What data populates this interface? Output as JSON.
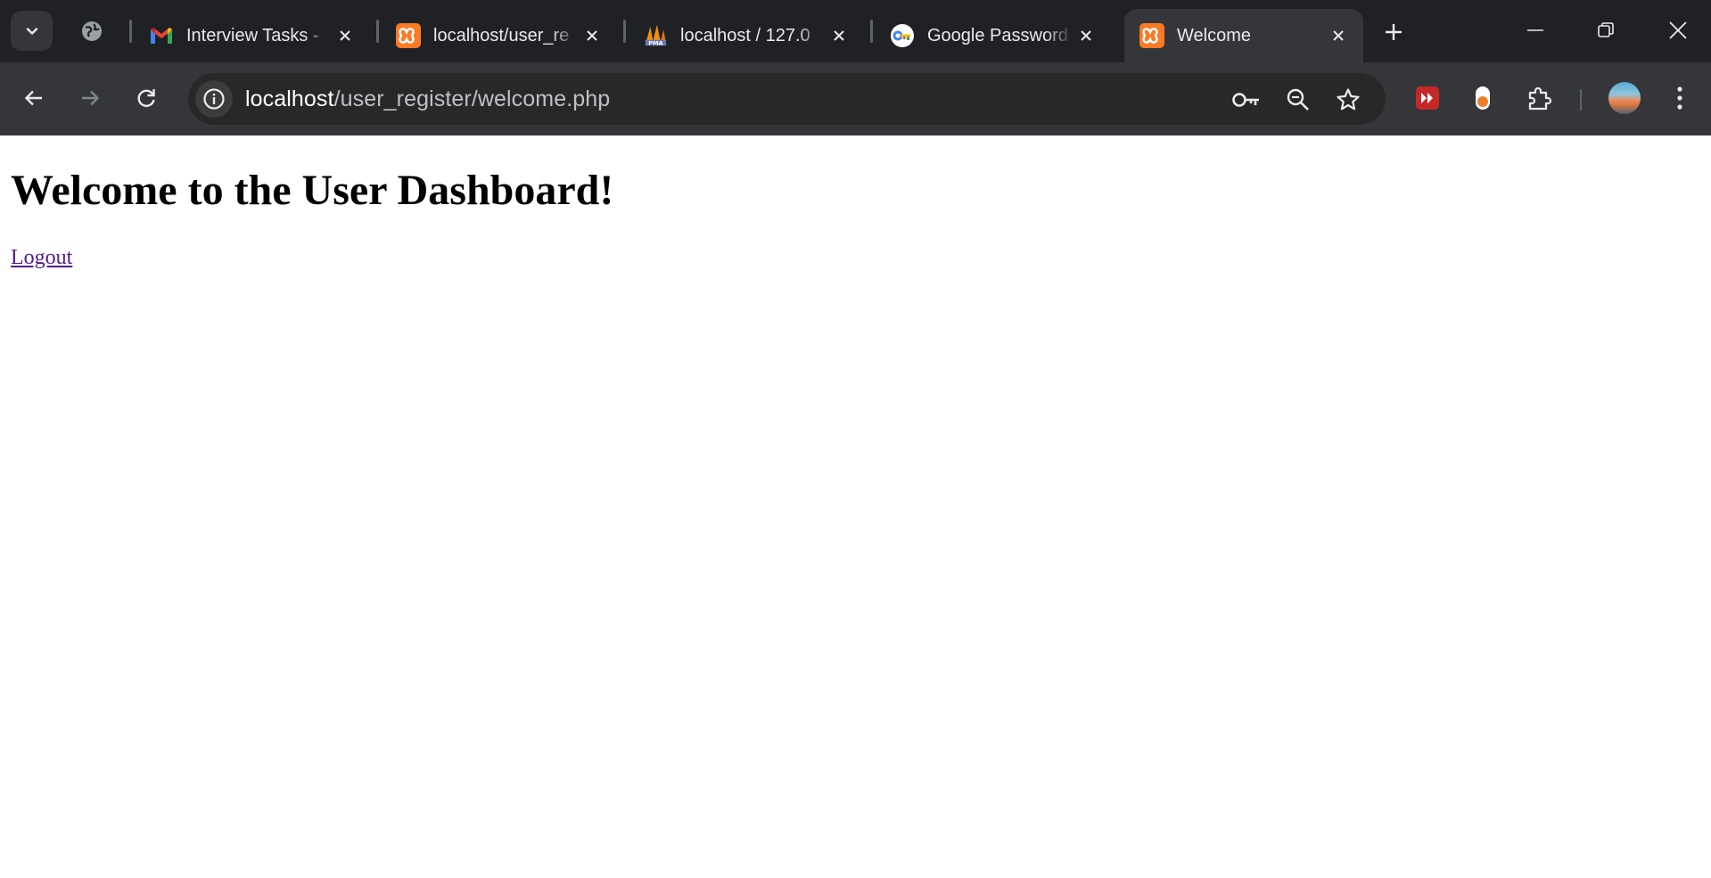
{
  "tabs": [
    {
      "title": "Interview Tasks - ",
      "favicon": "gmail-icon",
      "active": false
    },
    {
      "title": "localhost/user_re",
      "favicon": "xampp-icon",
      "active": false
    },
    {
      "title": "localhost / 127.0",
      "favicon": "phpmyadmin-icon",
      "active": false
    },
    {
      "title": "Google Password",
      "favicon": "google-password-manager-icon",
      "active": false
    },
    {
      "title": "Welcome",
      "favicon": "xampp-icon",
      "active": true
    }
  ],
  "address_bar": {
    "host": "localhost",
    "path": "/user_register/welcome.php"
  },
  "page": {
    "heading": "Welcome to the User Dashboard!",
    "logout_link": "Logout"
  },
  "colors": {
    "tabstrip_bg": "#202124",
    "toolbar_bg": "#35363a",
    "omnibox_bg": "#282828",
    "xampp_orange": "#fb7a24",
    "visited_link": "#551a8b"
  }
}
